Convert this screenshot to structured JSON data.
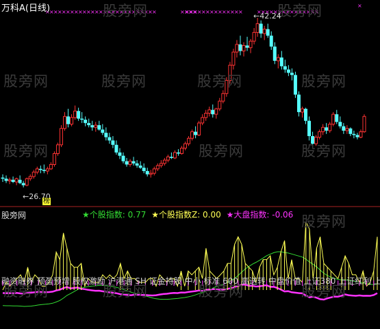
{
  "header": {
    "title": "万科A(日线)"
  },
  "watermark": "股旁网",
  "main_panel": {
    "high_label": "←42.24",
    "low_label": "←26.70",
    "low_marker": "榜"
  },
  "indicator_panel": {
    "source_label": "股旁网",
    "legend": [
      {
        "star": "★",
        "name": "个股指数",
        "value": "0.77",
        "color": "#33dd33"
      },
      {
        "star": "★",
        "name": "个股指数Z",
        "value": "0.00",
        "color": "#ffff55"
      },
      {
        "star": "★",
        "name": "大盘指数",
        "value": "-0.06",
        "color": "#ff33ff"
      }
    ],
    "ticker_text": "融资融券 预盈预增 股权激励 沪港通 SH 证金持股 中小 标准 600 高送转 中盘价值 上证380 上证红利 上证"
  },
  "colors": {
    "up": "#ff3333",
    "down": "#55ffff",
    "mark": "#ff33ff"
  },
  "chart_data": {
    "type": "candlestick",
    "title": "万科A(日线)",
    "annotations": [
      {
        "text": "←42.24",
        "value": 42.24
      },
      {
        "text": "←26.70",
        "value": 26.7
      }
    ],
    "ohlc": [
      [
        27.6,
        27.9,
        27.2,
        27.5
      ],
      [
        27.5,
        27.8,
        27.1,
        27.3
      ],
      [
        27.3,
        27.6,
        27.0,
        27.4
      ],
      [
        27.4,
        27.7,
        27.1,
        27.2
      ],
      [
        27.2,
        27.6,
        26.9,
        27.5
      ],
      [
        27.4,
        27.8,
        27.0,
        27.1
      ],
      [
        27.1,
        27.3,
        26.7,
        26.9
      ],
      [
        26.9,
        27.6,
        26.8,
        27.5
      ],
      [
        27.5,
        27.9,
        27.3,
        27.7
      ],
      [
        27.7,
        28.3,
        27.5,
        28.1
      ],
      [
        28.1,
        28.6,
        27.9,
        28.4
      ],
      [
        28.4,
        28.7,
        28.0,
        28.3
      ],
      [
        28.3,
        28.8,
        28.0,
        28.2
      ],
      [
        28.2,
        28.6,
        27.9,
        28.4
      ],
      [
        28.4,
        29.0,
        28.3,
        28.8
      ],
      [
        28.8,
        30.0,
        28.6,
        29.8
      ],
      [
        29.8,
        30.8,
        29.6,
        30.6
      ],
      [
        30.6,
        32.4,
        30.4,
        32.1
      ],
      [
        32.1,
        33.6,
        31.9,
        33.2
      ],
      [
        33.2,
        33.9,
        32.2,
        32.5
      ],
      [
        32.5,
        33.4,
        32.3,
        33.1
      ],
      [
        33.1,
        34.2,
        32.9,
        33.7
      ],
      [
        33.7,
        34.0,
        32.8,
        33.0
      ],
      [
        33.0,
        33.6,
        32.6,
        32.9
      ],
      [
        32.9,
        33.2,
        32.3,
        32.6
      ],
      [
        32.6,
        33.0,
        32.2,
        32.4
      ],
      [
        32.4,
        32.8,
        31.9,
        32.2
      ],
      [
        32.2,
        32.7,
        31.8,
        32.4
      ],
      [
        32.4,
        32.8,
        31.9,
        32.0
      ],
      [
        32.0,
        32.5,
        31.5,
        31.7
      ],
      [
        31.7,
        32.2,
        31.0,
        31.3
      ],
      [
        31.3,
        31.7,
        30.7,
        31.0
      ],
      [
        31.0,
        31.4,
        30.3,
        30.6
      ],
      [
        30.6,
        31.0,
        29.7,
        29.9
      ],
      [
        29.9,
        30.3,
        29.3,
        29.6
      ],
      [
        29.6,
        29.9,
        28.9,
        29.1
      ],
      [
        29.1,
        29.4,
        28.6,
        28.8
      ],
      [
        28.8,
        29.3,
        28.6,
        29.1
      ],
      [
        29.1,
        29.5,
        28.7,
        28.9
      ],
      [
        28.9,
        29.2,
        28.5,
        28.7
      ],
      [
        28.7,
        29.1,
        28.4,
        28.5
      ],
      [
        28.5,
        28.9,
        28.0,
        28.2
      ],
      [
        28.2,
        28.5,
        27.7,
        27.9
      ],
      [
        27.9,
        28.3,
        27.6,
        28.0
      ],
      [
        28.0,
        28.6,
        27.8,
        28.4
      ],
      [
        28.4,
        28.9,
        28.2,
        28.7
      ],
      [
        28.7,
        29.2,
        28.5,
        28.9
      ],
      [
        28.9,
        29.4,
        28.7,
        29.2
      ],
      [
        29.2,
        29.7,
        29.0,
        29.5
      ],
      [
        29.5,
        29.9,
        29.3,
        29.4
      ],
      [
        29.4,
        30.1,
        29.3,
        29.9
      ],
      [
        29.9,
        30.2,
        29.6,
        29.8
      ],
      [
        29.8,
        30.5,
        29.7,
        30.3
      ],
      [
        30.3,
        30.9,
        30.1,
        30.7
      ],
      [
        30.7,
        31.4,
        30.5,
        31.2
      ],
      [
        31.2,
        32.0,
        31.0,
        31.8
      ],
      [
        31.8,
        32.3,
        31.2,
        31.5
      ],
      [
        31.5,
        32.8,
        31.4,
        32.6
      ],
      [
        32.6,
        33.4,
        32.4,
        33.1
      ],
      [
        33.1,
        33.8,
        32.8,
        33.5
      ],
      [
        33.5,
        34.1,
        33.2,
        33.8
      ],
      [
        33.8,
        34.3,
        33.1,
        33.4
      ],
      [
        33.4,
        34.0,
        33.0,
        33.9
      ],
      [
        33.9,
        34.9,
        33.7,
        34.6
      ],
      [
        34.6,
        35.6,
        34.4,
        35.3
      ],
      [
        35.3,
        36.8,
        35.0,
        36.5
      ],
      [
        36.5,
        38.2,
        36.2,
        37.9
      ],
      [
        37.9,
        39.4,
        37.5,
        39.1
      ],
      [
        39.1,
        40.2,
        38.6,
        39.8
      ],
      [
        39.8,
        40.6,
        38.8,
        39.2
      ],
      [
        39.2,
        40.0,
        38.7,
        39.7
      ],
      [
        39.7,
        40.5,
        39.2,
        39.5
      ],
      [
        39.5,
        40.3,
        39.0,
        40.1
      ],
      [
        40.1,
        41.3,
        39.8,
        40.9
      ],
      [
        40.9,
        42.24,
        40.5,
        41.7
      ],
      [
        41.7,
        42.0,
        40.4,
        40.8
      ],
      [
        40.8,
        41.5,
        40.2,
        41.2
      ],
      [
        41.2,
        41.7,
        40.4,
        40.6
      ],
      [
        40.6,
        41.0,
        39.3,
        39.6
      ],
      [
        39.6,
        40.0,
        38.0,
        38.3
      ],
      [
        38.3,
        38.9,
        37.6,
        38.6
      ],
      [
        38.6,
        39.2,
        37.5,
        37.8
      ],
      [
        37.8,
        38.4,
        37.2,
        37.5
      ],
      [
        37.5,
        37.9,
        36.9,
        37.2
      ],
      [
        37.2,
        37.6,
        36.5,
        37.0
      ],
      [
        37.0,
        37.3,
        34.9,
        35.2
      ],
      [
        35.2,
        35.5,
        33.2,
        33.6
      ],
      [
        33.6,
        34.1,
        33.1,
        33.9
      ],
      [
        33.9,
        34.0,
        32.5,
        32.8
      ],
      [
        32.8,
        33.2,
        31.0,
        31.4
      ],
      [
        31.4,
        31.8,
        30.5,
        30.7
      ],
      [
        30.7,
        31.5,
        30.5,
        31.3
      ],
      [
        31.3,
        32.0,
        31.1,
        31.8
      ],
      [
        31.8,
        32.5,
        31.5,
        32.2
      ],
      [
        32.2,
        32.6,
        31.6,
        31.9
      ],
      [
        31.9,
        32.7,
        31.7,
        32.5
      ],
      [
        32.5,
        33.6,
        32.3,
        33.4
      ],
      [
        33.4,
        33.8,
        32.5,
        32.7
      ],
      [
        32.7,
        33.2,
        32.1,
        32.3
      ],
      [
        32.3,
        32.6,
        31.6,
        31.9
      ],
      [
        31.9,
        32.4,
        31.6,
        32.1
      ],
      [
        32.1,
        32.2,
        31.4,
        31.6
      ],
      [
        31.6,
        31.9,
        31.2,
        31.5
      ],
      [
        31.5,
        31.7,
        31.1,
        31.3
      ],
      [
        31.3,
        32.0,
        31.2,
        31.8
      ],
      [
        31.8,
        33.4,
        31.7,
        33.2
      ]
    ],
    "y_range": [
      26.7,
      42.24
    ]
  }
}
